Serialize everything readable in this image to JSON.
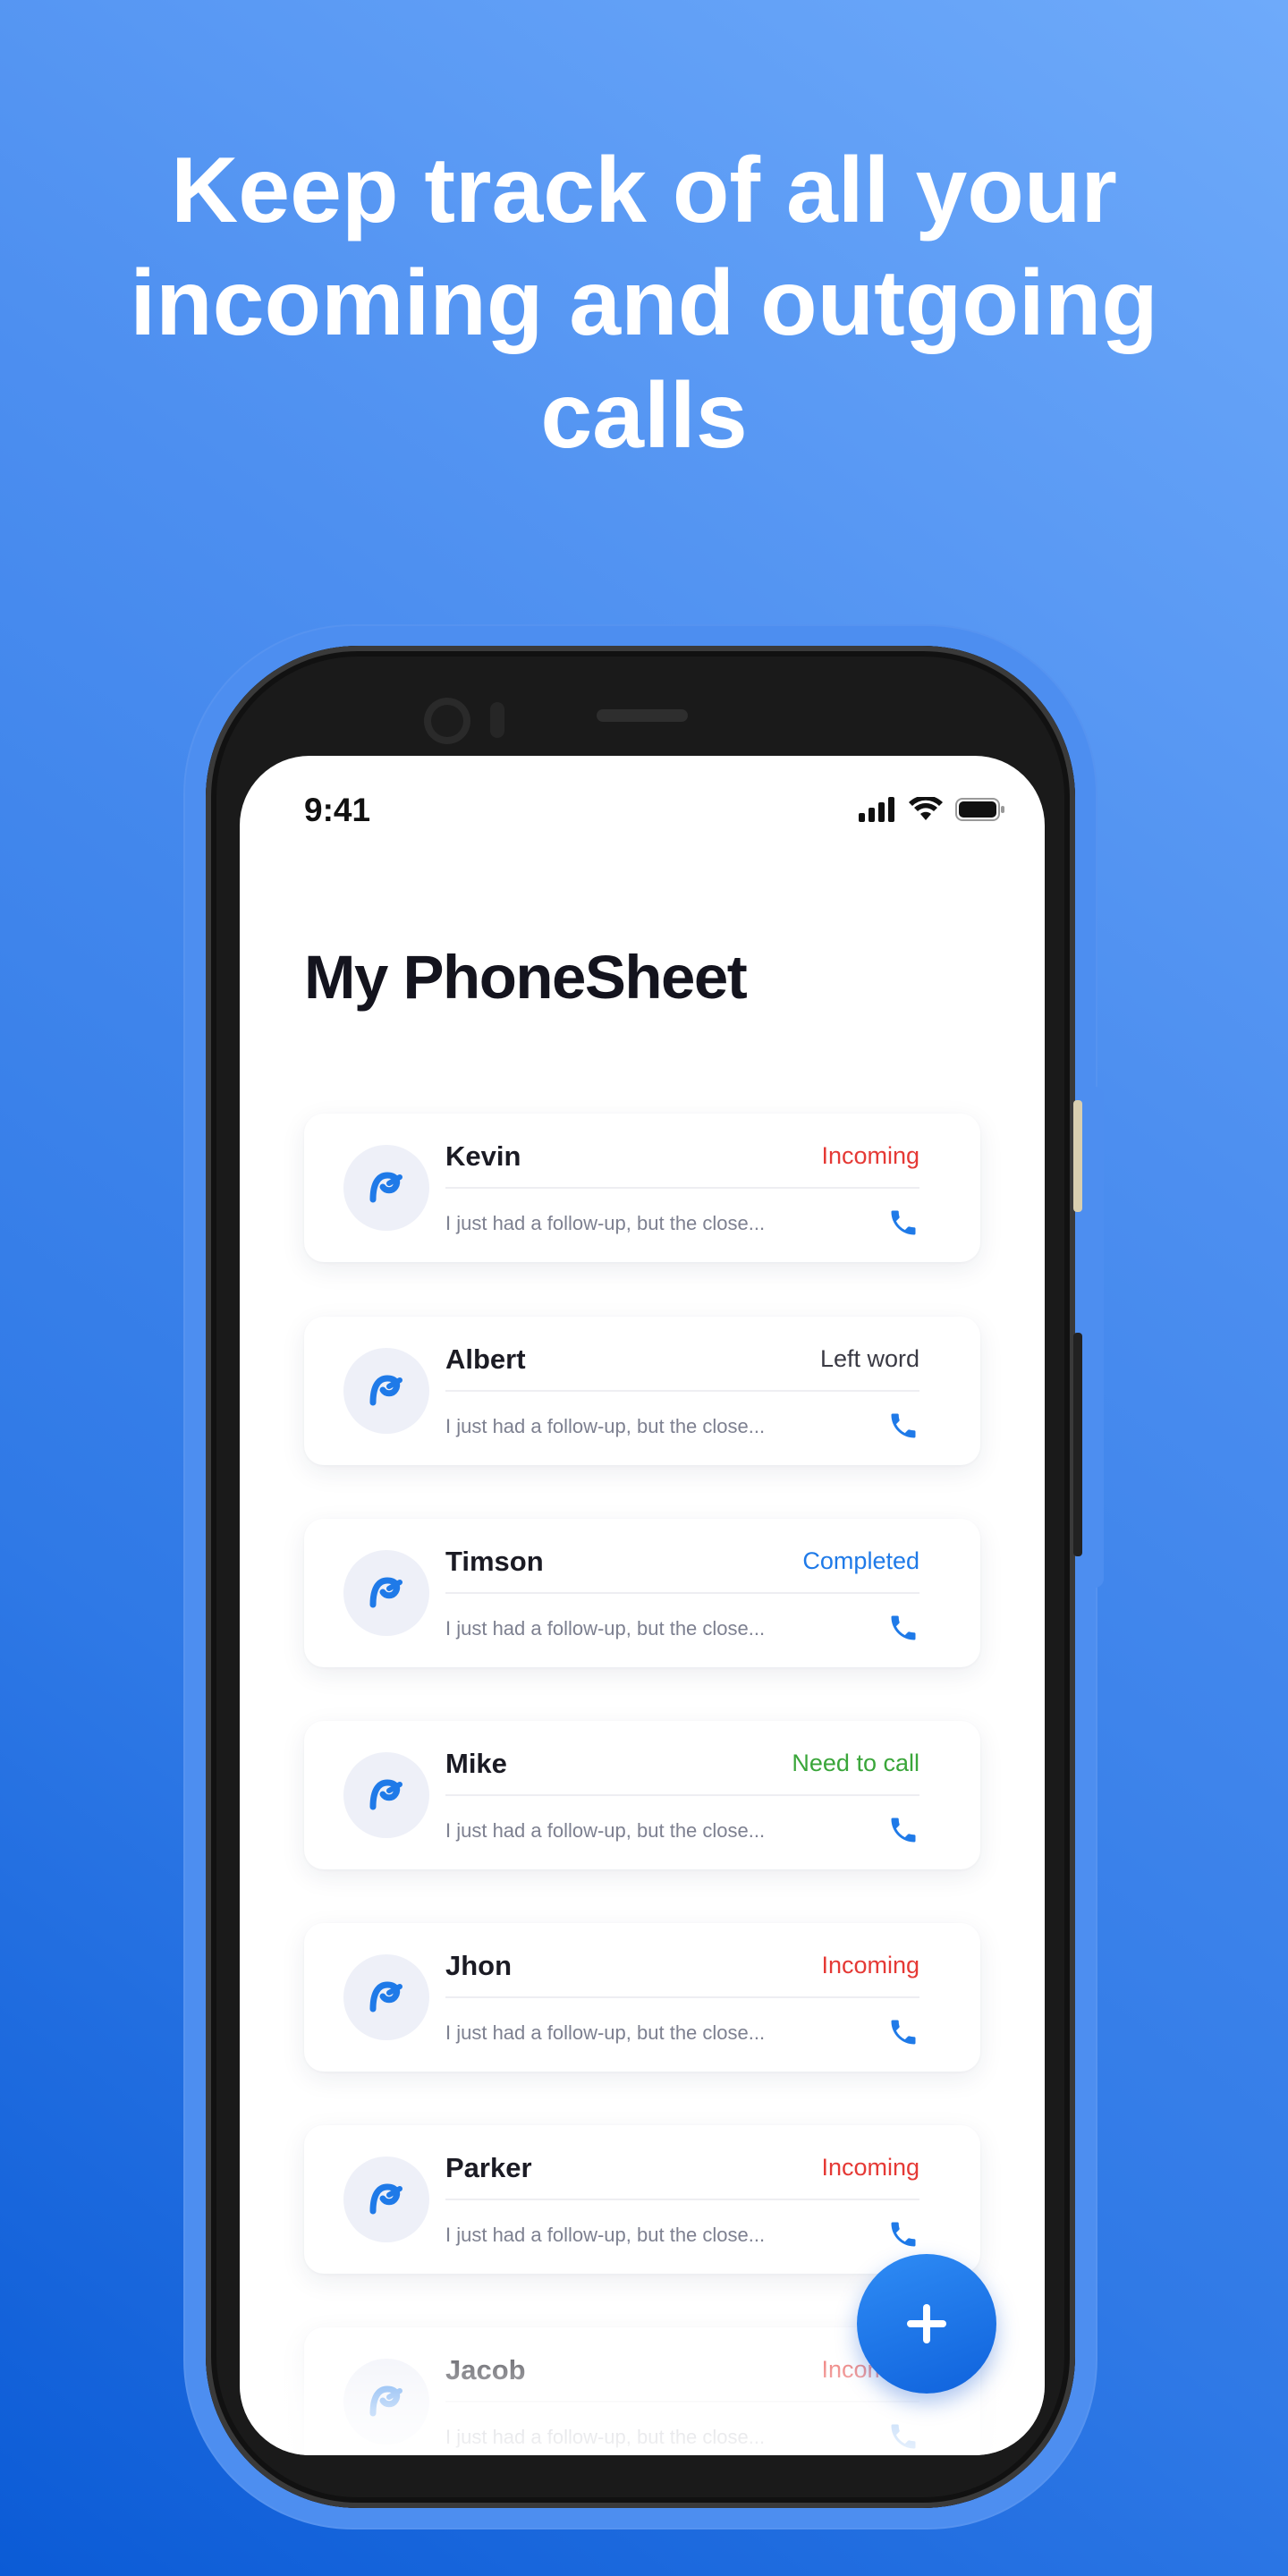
{
  "headline": {
    "line1": "Keep track of all your",
    "line2": "incoming and outgoing",
    "line3": "calls"
  },
  "status_bar": {
    "time": "9:41",
    "icons": [
      "signal-icon",
      "wifi-icon",
      "battery-icon"
    ]
  },
  "app": {
    "title": "My PhoneSheet"
  },
  "calls": [
    {
      "name": "Kevin",
      "status": "Incoming",
      "status_color": "#e53935",
      "preview": "I just had a follow-up, but the close..."
    },
    {
      "name": "Albert",
      "status": "Left word",
      "status_color": "#3a3a44",
      "preview": "I just had a follow-up, but the close..."
    },
    {
      "name": "Timson",
      "status": "Completed",
      "status_color": "#1f7ae8",
      "preview": "I just had a follow-up, but the close..."
    },
    {
      "name": "Mike",
      "status": "Need to call",
      "status_color": "#3aa63a",
      "preview": "I just had a follow-up, but the close..."
    },
    {
      "name": "Jhon",
      "status": "Incoming",
      "status_color": "#e53935",
      "preview": "I just had a follow-up, but the close..."
    },
    {
      "name": "Parker",
      "status": "Incoming",
      "status_color": "#e53935",
      "preview": "I just had a follow-up, but the close..."
    },
    {
      "name": "Jacob",
      "status": "Incoming",
      "status_color": "#e53935",
      "preview": "I just had a follow-up, but the close..."
    }
  ],
  "fab": {
    "icon": "plus-icon"
  },
  "colors": {
    "accent": "#1f7ae8",
    "background_top": "#6eaafa",
    "background_bottom": "#0b5bd6"
  }
}
